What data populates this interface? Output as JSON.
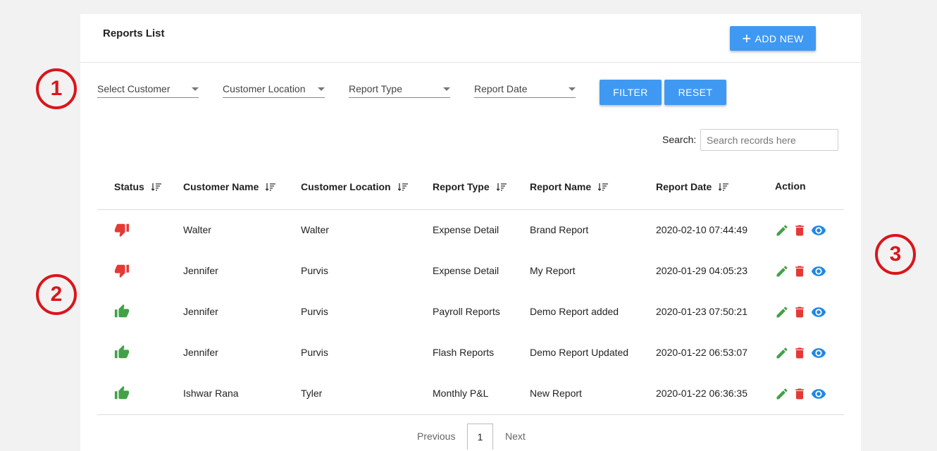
{
  "header": {
    "title": "Reports List",
    "add_new_label": "ADD NEW"
  },
  "filters": {
    "customer": "Select Customer",
    "location": "Customer Location",
    "report_type": "Report Type",
    "report_date": "Report Date",
    "filter_label": "FILTER",
    "reset_label": "RESET"
  },
  "search": {
    "label": "Search:",
    "placeholder": "Search records here",
    "value": ""
  },
  "table": {
    "columns": {
      "status": "Status",
      "customer_name": "Customer Name",
      "customer_location": "Customer Location",
      "report_type": "Report Type",
      "report_name": "Report Name",
      "report_date": "Report Date",
      "action": "Action"
    },
    "rows": [
      {
        "status": "thumbs-down",
        "customer_name": "Walter",
        "customer_location": "Walter",
        "report_type": "Expense Detail",
        "report_name": "Brand Report",
        "report_date": "2020-02-10 07:44:49"
      },
      {
        "status": "thumbs-down",
        "customer_name": "Jennifer",
        "customer_location": "Purvis",
        "report_type": "Expense Detail",
        "report_name": "My Report",
        "report_date": "2020-01-29 04:05:23"
      },
      {
        "status": "thumbs-up",
        "customer_name": "Jennifer",
        "customer_location": "Purvis",
        "report_type": "Payroll Reports",
        "report_name": "Demo Report added",
        "report_date": "2020-01-23 07:50:21"
      },
      {
        "status": "thumbs-up",
        "customer_name": "Jennifer",
        "customer_location": "Purvis",
        "report_type": "Flash Reports",
        "report_name": "Demo Report Updated",
        "report_date": "2020-01-22 06:53:07"
      },
      {
        "status": "thumbs-up",
        "customer_name": "Ishwar Rana",
        "customer_location": "Tyler",
        "report_type": "Monthly P&L",
        "report_name": "New Report",
        "report_date": "2020-01-22 06:36:35"
      }
    ]
  },
  "pagination": {
    "previous": "Previous",
    "current": "1",
    "next": "Next"
  },
  "markers": [
    "1",
    "2",
    "3"
  ],
  "colors": {
    "primary": "#3f99f3",
    "thumbs_down": "#e53935",
    "thumbs_up": "#43a047",
    "edit": "#43a047",
    "delete": "#e53935",
    "view": "#1e88e5",
    "marker": "#d9161b"
  }
}
